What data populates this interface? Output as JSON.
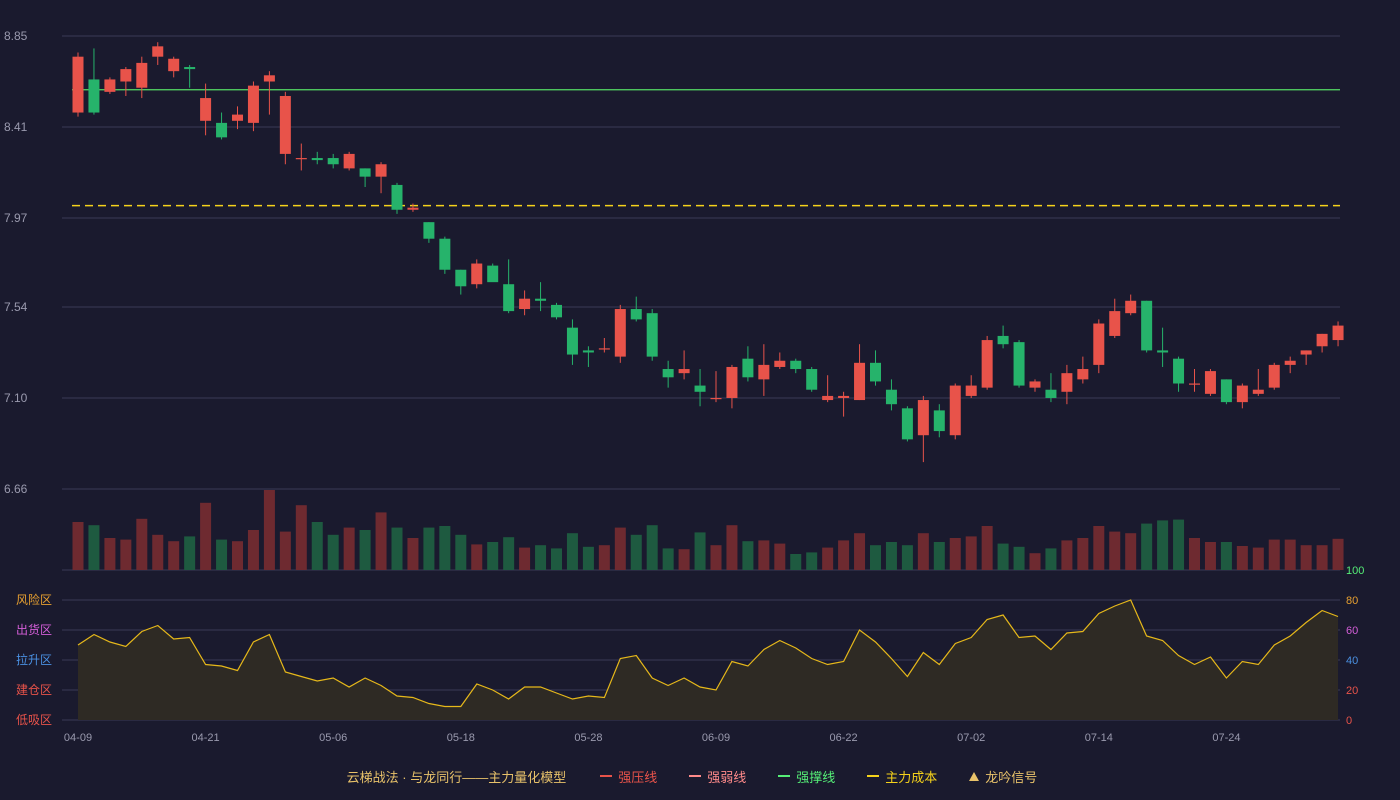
{
  "chart_data": {
    "type": "candlestick",
    "ylim": [
      6.66,
      8.85
    ],
    "y_ticks": [
      "8.85",
      "8.41",
      "7.97",
      "7.54",
      "7.10",
      "6.66"
    ],
    "x_ticks": [
      {
        "label": "04-09",
        "index": 0
      },
      {
        "label": "04-21",
        "index": 8
      },
      {
        "label": "05-06",
        "index": 16
      },
      {
        "label": "05-18",
        "index": 24
      },
      {
        "label": "05-28",
        "index": 32
      },
      {
        "label": "06-09",
        "index": 40
      },
      {
        "label": "06-22",
        "index": 48
      },
      {
        "label": "07-02",
        "index": 56
      },
      {
        "label": "07-14",
        "index": 64
      },
      {
        "label": "07-24",
        "index": 72
      }
    ],
    "resistance_level": 8.59,
    "cost_level": 8.03,
    "candles": [
      [
        8.48,
        8.75,
        8.46,
        8.77
      ],
      [
        8.64,
        8.48,
        8.47,
        8.79
      ],
      [
        8.58,
        8.64,
        8.57,
        8.65
      ],
      [
        8.63,
        8.69,
        8.56,
        8.7
      ],
      [
        8.6,
        8.72,
        8.55,
        8.75
      ],
      [
        8.75,
        8.8,
        8.71,
        8.82
      ],
      [
        8.68,
        8.74,
        8.65,
        8.75
      ],
      [
        8.7,
        8.69,
        8.6,
        8.71
      ],
      [
        8.44,
        8.55,
        8.37,
        8.62
      ],
      [
        8.43,
        8.36,
        8.35,
        8.48
      ],
      [
        8.44,
        8.47,
        8.4,
        8.51
      ],
      [
        8.43,
        8.61,
        8.39,
        8.63
      ],
      [
        8.63,
        8.66,
        8.47,
        8.68
      ],
      [
        8.28,
        8.56,
        8.23,
        8.58
      ],
      [
        8.26,
        8.26,
        8.2,
        8.33
      ],
      [
        8.26,
        8.25,
        8.23,
        8.29
      ],
      [
        8.26,
        8.23,
        8.21,
        8.28
      ],
      [
        8.21,
        8.28,
        8.2,
        8.29
      ],
      [
        8.21,
        8.17,
        8.12,
        8.21
      ],
      [
        8.17,
        8.23,
        8.09,
        8.24
      ],
      [
        8.13,
        8.01,
        7.99,
        8.14
      ],
      [
        8.01,
        8.02,
        8.0,
        8.04
      ],
      [
        7.95,
        7.87,
        7.85,
        7.95
      ],
      [
        7.87,
        7.72,
        7.7,
        7.88
      ],
      [
        7.72,
        7.64,
        7.6,
        7.72
      ],
      [
        7.65,
        7.75,
        7.63,
        7.77
      ],
      [
        7.74,
        7.66,
        7.67,
        7.75
      ],
      [
        7.65,
        7.52,
        7.51,
        7.77
      ],
      [
        7.53,
        7.58,
        7.5,
        7.62
      ],
      [
        7.58,
        7.57,
        7.52,
        7.66
      ],
      [
        7.55,
        7.49,
        7.48,
        7.56
      ],
      [
        7.44,
        7.31,
        7.26,
        7.48
      ],
      [
        7.33,
        7.32,
        7.25,
        7.35
      ],
      [
        7.34,
        7.34,
        7.32,
        7.39
      ],
      [
        7.3,
        7.53,
        7.27,
        7.55
      ],
      [
        7.53,
        7.48,
        7.47,
        7.59
      ],
      [
        7.51,
        7.3,
        7.28,
        7.53
      ],
      [
        7.24,
        7.2,
        7.15,
        7.28
      ],
      [
        7.22,
        7.24,
        7.19,
        7.33
      ],
      [
        7.16,
        7.13,
        7.06,
        7.24
      ],
      [
        7.1,
        7.1,
        7.08,
        7.23
      ],
      [
        7.1,
        7.25,
        7.05,
        7.26
      ],
      [
        7.29,
        7.2,
        7.18,
        7.35
      ],
      [
        7.19,
        7.26,
        7.11,
        7.36
      ],
      [
        7.25,
        7.28,
        7.24,
        7.32
      ],
      [
        7.28,
        7.24,
        7.22,
        7.29
      ],
      [
        7.24,
        7.14,
        7.13,
        7.25
      ],
      [
        7.09,
        7.11,
        7.08,
        7.21
      ],
      [
        7.1,
        7.11,
        7.01,
        7.13
      ],
      [
        7.09,
        7.27,
        7.09,
        7.36
      ],
      [
        7.27,
        7.18,
        7.16,
        7.33
      ],
      [
        7.14,
        7.07,
        7.04,
        7.19
      ],
      [
        7.05,
        6.9,
        6.89,
        7.06
      ],
      [
        6.92,
        7.09,
        6.79,
        7.11
      ],
      [
        7.04,
        6.94,
        6.91,
        7.07
      ],
      [
        6.92,
        7.16,
        6.9,
        7.17
      ],
      [
        7.11,
        7.16,
        7.1,
        7.21
      ],
      [
        7.15,
        7.38,
        7.14,
        7.4
      ],
      [
        7.4,
        7.36,
        7.34,
        7.45
      ],
      [
        7.37,
        7.16,
        7.15,
        7.38
      ],
      [
        7.15,
        7.18,
        7.13,
        7.19
      ],
      [
        7.14,
        7.1,
        7.08,
        7.22
      ],
      [
        7.13,
        7.22,
        7.07,
        7.26
      ],
      [
        7.19,
        7.24,
        7.17,
        7.3
      ],
      [
        7.26,
        7.46,
        7.22,
        7.48
      ],
      [
        7.4,
        7.52,
        7.39,
        7.58
      ],
      [
        7.51,
        7.57,
        7.5,
        7.6
      ],
      [
        7.57,
        7.33,
        7.32,
        7.57
      ],
      [
        7.33,
        7.32,
        7.25,
        7.44
      ],
      [
        7.29,
        7.17,
        7.13,
        7.3
      ],
      [
        7.17,
        7.17,
        7.13,
        7.24
      ],
      [
        7.12,
        7.23,
        7.11,
        7.24
      ],
      [
        7.19,
        7.08,
        7.07,
        7.19
      ],
      [
        7.08,
        7.16,
        7.05,
        7.17
      ],
      [
        7.12,
        7.14,
        7.11,
        7.24
      ],
      [
        7.15,
        7.26,
        7.14,
        7.27
      ],
      [
        7.26,
        7.28,
        7.22,
        7.3
      ],
      [
        7.31,
        7.33,
        7.26,
        7.33
      ],
      [
        7.35,
        7.41,
        7.32,
        7.41
      ],
      [
        7.38,
        7.45,
        7.35,
        7.47
      ]
    ],
    "volume_bars": [
      0.6,
      0.56,
      0.4,
      0.38,
      0.64,
      0.44,
      0.36,
      0.42,
      0.84,
      0.38,
      0.36,
      0.5,
      1.0,
      0.48,
      0.81,
      0.6,
      0.44,
      0.53,
      0.5,
      0.72,
      0.53,
      0.4,
      0.53,
      0.55,
      0.44,
      0.32,
      0.35,
      0.41,
      0.28,
      0.31,
      0.27,
      0.46,
      0.29,
      0.31,
      0.53,
      0.44,
      0.56,
      0.27,
      0.26,
      0.47,
      0.31,
      0.56,
      0.36,
      0.37,
      0.33,
      0.2,
      0.22,
      0.28,
      0.37,
      0.46,
      0.31,
      0.35,
      0.31,
      0.46,
      0.35,
      0.4,
      0.42,
      0.55,
      0.33,
      0.29,
      0.21,
      0.27,
      0.37,
      0.4,
      0.55,
      0.48,
      0.46,
      0.58,
      0.62,
      0.63,
      0.4,
      0.35,
      0.35,
      0.3,
      0.28,
      0.38,
      0.38,
      0.31,
      0.31,
      0.39
    ],
    "indicator": {
      "ylim": [
        0,
        100
      ],
      "right_ticks": [
        "100",
        "80",
        "60",
        "40",
        "20",
        "0"
      ],
      "zones": [
        "风险区",
        "出货区",
        "拉升区",
        "建仓区",
        "低吸区"
      ],
      "values": [
        50,
        57,
        52,
        49,
        59,
        63,
        54,
        55,
        37,
        36,
        33,
        52,
        57,
        32,
        29,
        26,
        28,
        22,
        28,
        23,
        16,
        15,
        11,
        9,
        9,
        24,
        20,
        14,
        22,
        22,
        18,
        14,
        16,
        15,
        41,
        43,
        28,
        23,
        28,
        22,
        20,
        39,
        36,
        47,
        53,
        48,
        41,
        37,
        39,
        60,
        52,
        41,
        29,
        45,
        37,
        51,
        55,
        67,
        70,
        55,
        56,
        47,
        58,
        59,
        71,
        76,
        80,
        56,
        53,
        43,
        37,
        42,
        28,
        39,
        37,
        50,
        56,
        65,
        73,
        69
      ]
    },
    "legend": {
      "title": "云梯战法 · 与龙同行——主力量化模型",
      "items": [
        {
          "label": "强压线",
          "color": "#e8534a",
          "style": "solid"
        },
        {
          "label": "强弱线",
          "color": "#ff8a8a",
          "style": "dashed"
        },
        {
          "label": "强撑线",
          "color": "#55ee77",
          "style": "solid"
        },
        {
          "label": "主力成本",
          "color": "#f5d21b",
          "style": "dashed"
        },
        {
          "label": "龙吟信号",
          "color": "#e8c26a",
          "style": "triangle"
        }
      ]
    },
    "colors": {
      "up": "#e8534a",
      "down": "#26b36b",
      "vol_up": "#6e2a30",
      "vol_down": "#1e5a40",
      "grid": "#3a3a55",
      "axis_text": "#9a9aae",
      "resistance_line": "#55dd66",
      "cost_line": "#f5d21b",
      "indicator_line": "#e6b81a",
      "indicator_fill": "#2e2a24",
      "right_tick_colors": [
        "#55ee77",
        "#e8a030",
        "#d45ed8",
        "#4a90e2",
        "#e8534a",
        "#e8534a"
      ],
      "zone_colors": [
        "#e8a030",
        "#d45ed8",
        "#4a90e2",
        "#e8534a",
        "#e8534a"
      ]
    }
  }
}
